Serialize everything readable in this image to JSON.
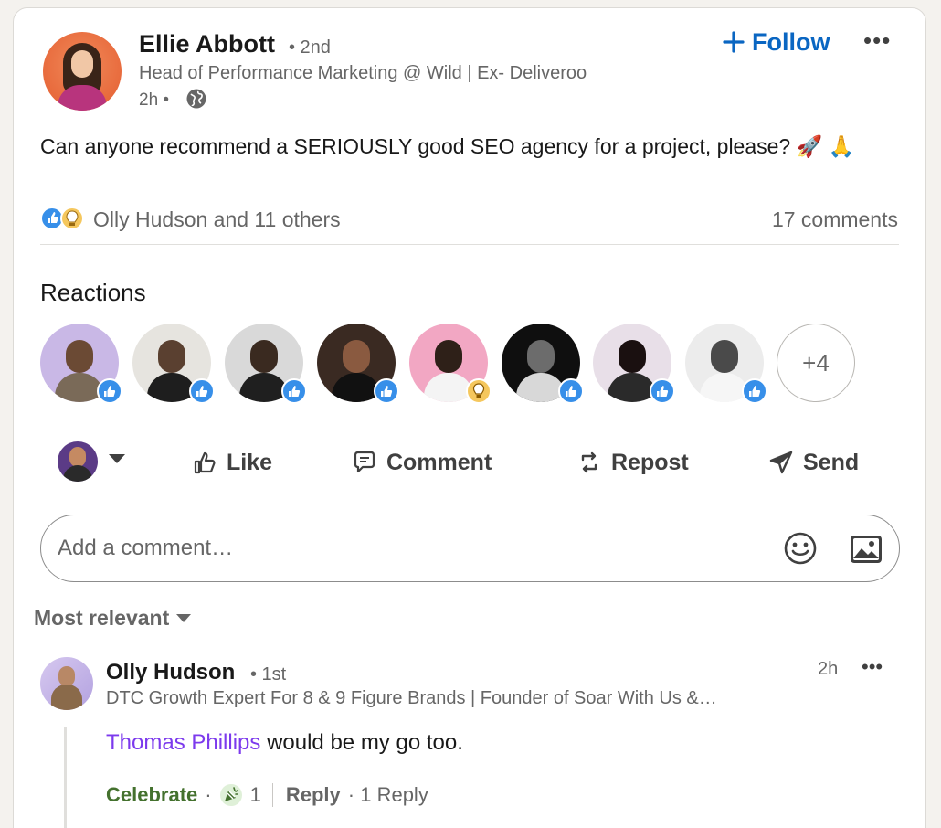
{
  "post": {
    "author_name": "Ellie Abbott",
    "degree": "• 2nd",
    "headline": "Head of Performance Marketing @ Wild | Ex- Deliveroo",
    "time": "2h •",
    "follow_label": "Follow",
    "more_label": "•••",
    "text": "Can anyone recommend a SERIOUSLY good SEO agency for a project, please? 🚀 🙏",
    "reactions_summary": "Olly Hudson and 11 others",
    "comments_count": "17 comments"
  },
  "reactions": {
    "title": "Reactions",
    "more_count": "+4",
    "people": [
      {
        "name": "reactor-1",
        "reaction": "like",
        "bg": "#c9b8e6",
        "hair": "#6b4a34",
        "shirt": "#7a6a58"
      },
      {
        "name": "reactor-2",
        "reaction": "like",
        "bg": "#e6e4df",
        "hair": "#5a4030",
        "shirt": "#1e1e1e"
      },
      {
        "name": "reactor-3",
        "reaction": "like",
        "bg": "#d9d9d9",
        "hair": "#3a2a20",
        "shirt": "#1f1f1f"
      },
      {
        "name": "reactor-4",
        "reaction": "like",
        "bg": "#3a2a22",
        "hair": "#8a5a40",
        "shirt": "#111111"
      },
      {
        "name": "reactor-5",
        "reaction": "insight",
        "bg": "#f2a7c3",
        "hair": "#2e2018",
        "shirt": "#f4f4f4"
      },
      {
        "name": "reactor-6",
        "reaction": "like",
        "bg": "#0f0f0f",
        "hair": "#6c6c6c",
        "shirt": "#d8d8d8"
      },
      {
        "name": "reactor-7",
        "reaction": "like",
        "bg": "#e8dfe8",
        "hair": "#1a1010",
        "shirt": "#2a2a2a"
      },
      {
        "name": "reactor-8",
        "reaction": "like",
        "bg": "#ececec",
        "hair": "#4a4a4a",
        "shirt": "#f6f6f6"
      }
    ]
  },
  "actions": {
    "like": "Like",
    "comment": "Comment",
    "repost": "Repost",
    "send": "Send"
  },
  "comment_box": {
    "placeholder": "Add a comment…"
  },
  "sort": {
    "label": "Most relevant"
  },
  "comment": {
    "author_name": "Olly Hudson",
    "degree": "• 1st",
    "headline": "DTC Growth Expert For 8 & 9 Figure Brands | Founder of Soar With Us &…",
    "time": "2h",
    "more_label": "•••",
    "mention": "Thomas Phillips",
    "text": " would be my go too.",
    "reaction_label": "Celebrate",
    "reaction_count": "1",
    "reply_label": "Reply",
    "replies_count": "· 1 Reply"
  },
  "colors": {
    "brand_blue": "#0a66c2",
    "like_blue": "#378fe9",
    "mention_purple": "#7c3aed",
    "celebrate_green": "#44712e"
  }
}
